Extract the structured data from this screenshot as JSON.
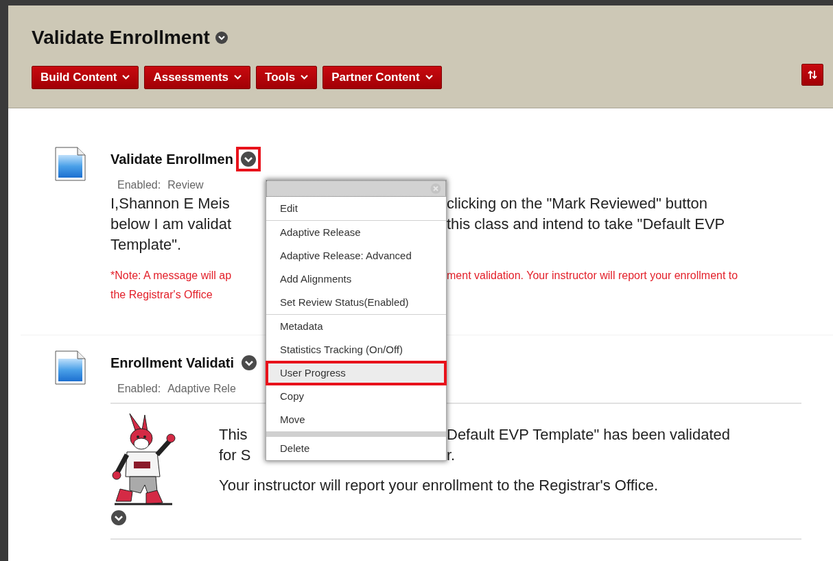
{
  "page": {
    "title": "Validate Enrollment"
  },
  "toolbar": {
    "buttons": [
      {
        "label": "Build Content"
      },
      {
        "label": "Assessments"
      },
      {
        "label": "Tools"
      },
      {
        "label": "Partner Content"
      }
    ]
  },
  "items": [
    {
      "kind": "review",
      "title": "Validate Enrollmen",
      "menu_highlighted": true,
      "status_label": "Enabled:",
      "status_value": "Review",
      "body_lines": [
        {
          "left": "I,Shannon E Meis",
          "right": "clicking on the \"Mark Reviewed\" button"
        },
        {
          "left": "below I am validat",
          "right": "this class and intend to take \"Default EVP"
        },
        {
          "left": "Template\"."
        }
      ],
      "note_lines": [
        {
          "left": "*Note: A message will ap",
          "right": "ment validation. Your instructor will report your enrollment to"
        },
        {
          "left": "the Registrar's Office"
        }
      ]
    },
    {
      "kind": "message",
      "title": "Enrollment Validati",
      "menu_highlighted": false,
      "status_label": "Enabled:",
      "status_value": "Adaptive Rele",
      "body_lines": [
        {
          "left": "This",
          "right": "Default EVP Template\" has been validated"
        },
        {
          "left": "for S",
          "right": "r."
        }
      ],
      "final_line": "Your instructor will report your enrollment to the Registrar's Office."
    }
  ],
  "context_menu": {
    "groups": [
      [
        {
          "label": "Edit",
          "highlighted": false
        }
      ],
      [
        {
          "label": "Adaptive Release",
          "highlighted": false
        },
        {
          "label": "Adaptive Release: Advanced",
          "highlighted": false
        },
        {
          "label": "Add Alignments",
          "highlighted": false
        },
        {
          "label": "Set Review Status(Enabled)",
          "highlighted": false
        }
      ],
      [
        {
          "label": "Metadata",
          "highlighted": false
        },
        {
          "label": "Statistics Tracking (On/Off)",
          "highlighted": false
        },
        {
          "label": "User Progress",
          "highlighted": true
        },
        {
          "label": "Copy",
          "highlighted": false
        },
        {
          "label": "Move",
          "highlighted": false
        }
      ],
      [
        {
          "label": "Delete",
          "highlighted": false
        }
      ]
    ]
  }
}
